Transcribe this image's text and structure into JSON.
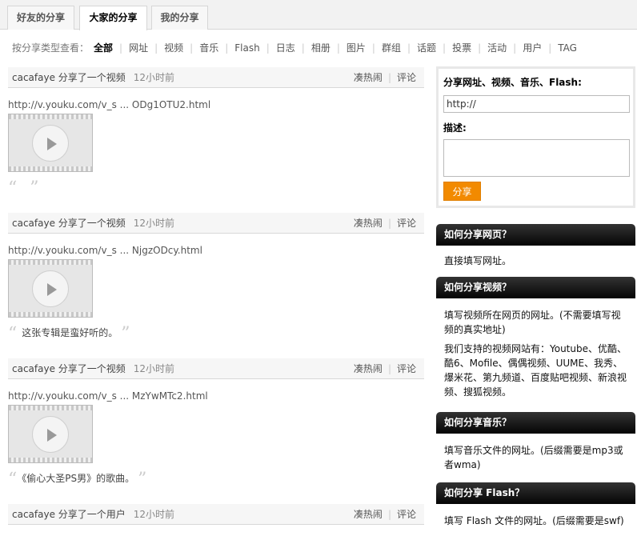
{
  "tabs": [
    {
      "label": "好友的分享"
    },
    {
      "label": "大家的分享",
      "active": true
    },
    {
      "label": "我的分享"
    }
  ],
  "filter": {
    "label": "按分享类型查看：",
    "items": [
      "全部",
      "网址",
      "视频",
      "音乐",
      "Flash",
      "日志",
      "相册",
      "图片",
      "群组",
      "话题",
      "投票",
      "活动",
      "用户",
      "TAG"
    ],
    "selected": "全部"
  },
  "feed": [
    {
      "who": "cacafaye 分享了一个视频",
      "when": "12小时前",
      "hot": "凑热闹",
      "comment": "评论",
      "url": "http://v.youku.com/v_s ... ODg1OTU2.html",
      "quote": ""
    },
    {
      "who": "cacafaye 分享了一个视频",
      "when": "12小时前",
      "hot": "凑热闹",
      "comment": "评论",
      "url": "http://v.youku.com/v_s ... NjgzODcy.html",
      "quote": "这张专辑是蛮好听的。"
    },
    {
      "who": "cacafaye 分享了一个视频",
      "when": "12小时前",
      "hot": "凑热闹",
      "comment": "评论",
      "url": "http://v.youku.com/v_s ... MzYwMTc2.html",
      "quote": "《偷心大圣PS男》的歌曲。"
    },
    {
      "who": "cacafaye 分享了一个用户",
      "when": "12小时前",
      "hot": "凑热闹",
      "comment": "评论"
    }
  ],
  "sharebox": {
    "title": "分享网址、视频、音乐、Flash:",
    "url_value": "http://",
    "desc_label": "描述:",
    "button": "分享"
  },
  "help": [
    {
      "title": "如何分享网页？",
      "paras": [
        "直接填写网址。"
      ]
    },
    {
      "title": "如何分享视频？",
      "paras": [
        "填写视频所在网页的网址。(不需要填写视频的真实地址)",
        "我们支持的视频网站有：Youtube、优酷、酷6、Mofile、偶偶视频、UUME、我秀、爆米花、第九频道、百度贴吧视频、新浪视频、搜狐视频。"
      ]
    },
    {
      "title": "如何分享音乐？",
      "paras": [
        "填写音乐文件的网址。(后缀需要是mp3或者wma)"
      ]
    },
    {
      "title": "如何分享 Flash？",
      "paras": [
        "填写 Flash 文件的网址。(后缀需要是swf)"
      ]
    }
  ],
  "colors": {
    "share_button": "#f28a00",
    "help_header": "#111111"
  }
}
